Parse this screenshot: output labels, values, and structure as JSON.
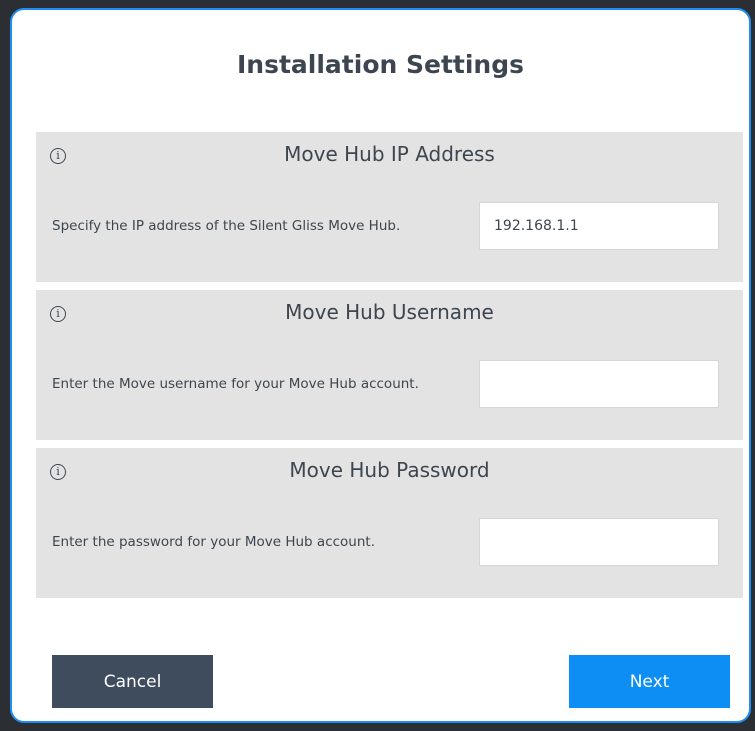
{
  "dialog": {
    "title": "Installation Settings"
  },
  "sections": [
    {
      "title": "Move Hub IP Address",
      "description": "Specify the IP address of the Silent Gliss Move Hub.",
      "value": "192.168.1.1",
      "placeholder": ""
    },
    {
      "title": "Move Hub Username",
      "description": "Enter the Move username for your Move Hub account.",
      "value": "",
      "placeholder": ""
    },
    {
      "title": "Move Hub Password",
      "description": "Enter the password for your Move Hub account.",
      "value": "",
      "placeholder": ""
    }
  ],
  "icons": {
    "info": "info-icon"
  },
  "buttons": {
    "cancel": "Cancel",
    "next": "Next"
  },
  "colors": {
    "accent": "#0d8ef5",
    "cancel_bg": "#3e4c5e",
    "section_bg": "#e3e3e3",
    "text": "#3d4650"
  }
}
